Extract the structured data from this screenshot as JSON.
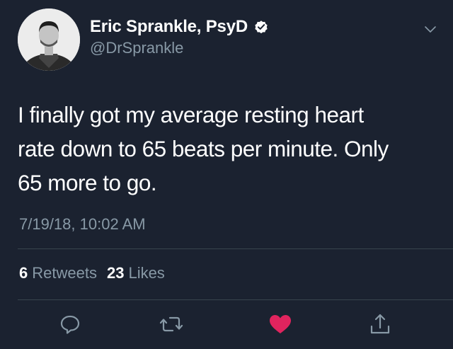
{
  "user": {
    "display_name": "Eric Sprankle, PsyD",
    "handle": "@DrSprankle",
    "verified": true
  },
  "tweet": {
    "text_lines": [
      "I finally got my average resting heart",
      "rate down to 65 beats per minute. Only",
      "65 more to go."
    ],
    "timestamp": "7/19/18, 10:02 AM"
  },
  "stats": {
    "retweets_count": "6",
    "retweets_label": "Retweets",
    "likes_count": "23",
    "likes_label": "Likes"
  },
  "actions": [
    {
      "name": "reply",
      "icon": "reply-icon"
    },
    {
      "name": "retweet",
      "icon": "retweet-icon"
    },
    {
      "name": "like",
      "icon": "heart-icon",
      "active": true
    },
    {
      "name": "share",
      "icon": "share-icon"
    }
  ],
  "colors": {
    "background": "#1b2230",
    "secondary_text": "#8899a6",
    "divider": "#38444d",
    "like_active": "#e0245e"
  }
}
